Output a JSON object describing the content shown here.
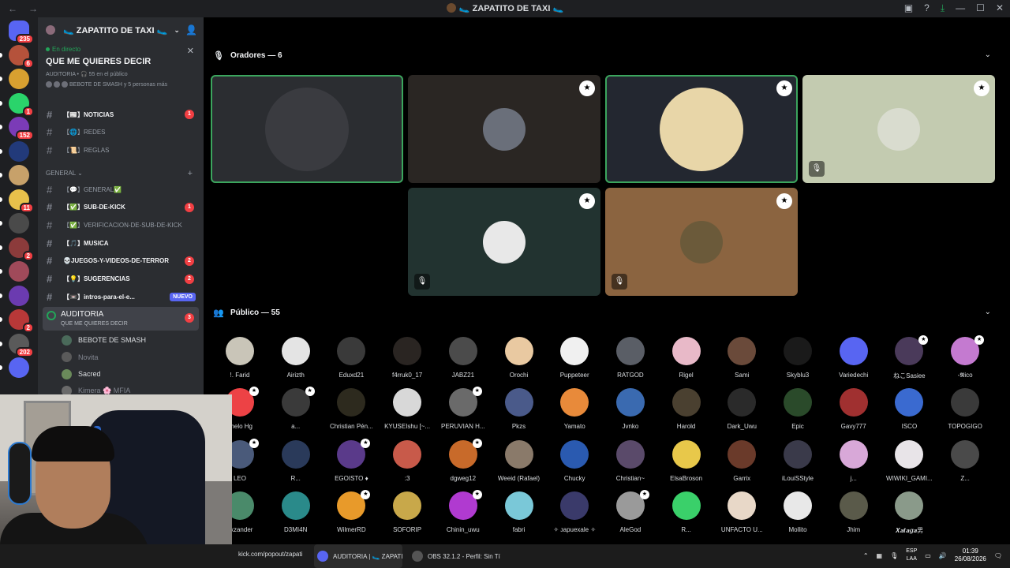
{
  "titlebar": {
    "back": "←",
    "forward": "→",
    "title": "🥿 ZAPATITO DE TAXI 🥿",
    "icons": [
      "inbox-icon",
      "help-icon",
      "download-icon"
    ],
    "min": "—",
    "max": "☐",
    "close": "✕"
  },
  "guilds": [
    {
      "name": "home-icon",
      "color": "#5865f2",
      "badge": "235"
    },
    {
      "name": "server-1",
      "color": "#b5523b",
      "badge": "6"
    },
    {
      "name": "server-2",
      "color": "#d8a030",
      "badge": ""
    },
    {
      "name": "server-kick",
      "color": "#2ad46b",
      "badge": "1"
    },
    {
      "name": "server-4",
      "color": "#7b3bb7",
      "badge": "152"
    },
    {
      "name": "server-kp",
      "color": "#223a7a",
      "badge": ""
    },
    {
      "name": "server-6",
      "color": "#c7a16a",
      "badge": ""
    },
    {
      "name": "server-7",
      "color": "#e8c14b",
      "badge": "11"
    },
    {
      "name": "server-8",
      "color": "#4a4a4a",
      "badge": ""
    },
    {
      "name": "server-9",
      "color": "#8c3b3b",
      "badge": "2"
    },
    {
      "name": "server-10",
      "color": "#a04a5a",
      "badge": ""
    },
    {
      "name": "server-11",
      "color": "#6b3bb0",
      "badge": ""
    },
    {
      "name": "server-12",
      "color": "#b83838",
      "badge": "2"
    },
    {
      "name": "server-13",
      "color": "#5a5a5a",
      "badge": "202"
    },
    {
      "name": "server-14",
      "color": "#5865f2",
      "badge": ""
    }
  ],
  "server": {
    "name": "🥿 ZAPATITO DE TAXI 🥿",
    "stage": {
      "live": "En directo",
      "title": "QUE ME QUIERES DECIR",
      "meta": "AUDITORIA • 🎧 55 en el público",
      "people": "BEBOTE DE SMASH y 5 personas más"
    },
    "channels": [
      {
        "label": "【📰】NOTICIAS",
        "bold": true,
        "badge": "1"
      },
      {
        "label": "【🌐】REDES",
        "bold": false,
        "badge": ""
      },
      {
        "label": "【📜】REGLAS",
        "bold": false,
        "badge": ""
      }
    ],
    "category": "GENERAL",
    "channels2": [
      {
        "label": "【💬】GENERAL✅",
        "bold": false,
        "badge": ""
      },
      {
        "label": "【✅】SUB-DE-KICK",
        "bold": true,
        "badge": "1"
      },
      {
        "label": "【✅】VERIFICACION-DE-SUB-DE-KICK",
        "bold": false,
        "badge": ""
      },
      {
        "label": "【🎵】MUSICA",
        "bold": true,
        "badge": ""
      },
      {
        "label": "💀JUEGOS-Y-VIDEOS-DE-TERROR",
        "bold": true,
        "badge": "2"
      },
      {
        "label": "【💡】SUGERENCIAS",
        "bold": true,
        "badge": "2"
      },
      {
        "label": "【📼】intros-para-el-e...",
        "bold": true,
        "badge": "NUEVO"
      }
    ],
    "stage_channel": {
      "name": "AUDITORIA",
      "sub": "QUE ME QUIERES DECIR",
      "badge": "3"
    },
    "voice_users": [
      {
        "name": "BEBOTE DE SMASH",
        "dim": false
      },
      {
        "name": "Novita",
        "dim": true
      },
      {
        "name": "Sacred",
        "dim": false
      },
      {
        "name": "Kimera 🌸 MFIA",
        "dim": true
      }
    ]
  },
  "speakers": {
    "header": "Oradores — 6",
    "tiles": [
      {
        "name": "speaker-1",
        "bg": "#2b2d31",
        "avatar": "#3a3b40",
        "speaking": true,
        "mod": false,
        "muted": false,
        "big": true
      },
      {
        "name": "speaker-2",
        "bg": "#2a2623",
        "avatar": "#6a6f7a",
        "speaking": false,
        "mod": true,
        "muted": false,
        "big": false
      },
      {
        "name": "speaker-3",
        "bg": "#232730",
        "avatar": "#e8d6a8",
        "speaking": true,
        "mod": true,
        "muted": false,
        "big": true
      },
      {
        "name": "speaker-4",
        "bg": "#c3cbb0",
        "avatar": "#d9dccf",
        "speaking": false,
        "mod": true,
        "muted": true,
        "big": false
      },
      {
        "name": "speaker-5",
        "bg": "#223330",
        "avatar": "#e8e8e8",
        "speaking": false,
        "mod": true,
        "muted": true,
        "big": false
      },
      {
        "name": "speaker-6",
        "bg": "#8b6440",
        "avatar": "#6b5a3a",
        "speaking": false,
        "mod": true,
        "muted": true,
        "big": false
      }
    ]
  },
  "audience": {
    "header": "Público — 55",
    "rows": [
      [
        {
          "name": "!. Farid",
          "color": "#c9c5b8",
          "mod": false
        },
        {
          "name": "Airizth",
          "color": "#e4e4e4",
          "mod": false
        },
        {
          "name": "Eduxd21",
          "color": "#3a3a3a",
          "mod": false
        },
        {
          "name": "f4rruk0_17",
          "color": "#2a2522",
          "mod": false
        },
        {
          "name": "JABZ21",
          "color": "#4b4b4b",
          "mod": false
        },
        {
          "name": "Orochi",
          "color": "#e9c9a1",
          "mod": false
        },
        {
          "name": "Puppeteer",
          "color": "#f0f0f0",
          "mod": false
        },
        {
          "name": "RATGOD",
          "color": "#5a5e66",
          "mod": false
        },
        {
          "name": "Rigel",
          "color": "#e8b9c8",
          "mod": false
        },
        {
          "name": "Sami",
          "color": "#6a4a3a",
          "mod": false
        },
        {
          "name": "Skyblu3",
          "color": "#1a1a1a",
          "mod": false
        },
        {
          "name": "Variedechi",
          "color": "#5865f2",
          "mod": false
        },
        {
          "name": "ねこSasiee",
          "color": "#4a3a5a",
          "mod": true
        },
        {
          "name": "-𝕹ico",
          "color": "#c47ad0",
          "mod": true
        }
      ],
      [
        {
          "name": "ghelo Hg",
          "color": "#ed4245",
          "mod": true
        },
        {
          "name": "a...",
          "color": "#3a3a3a",
          "mod": true
        },
        {
          "name": "Christian Pén...",
          "color": "#2d2a1e",
          "mod": false
        },
        {
          "name": "KYUSEIshu [~...",
          "color": "#d8d8d8",
          "mod": false
        },
        {
          "name": "PERUVIAN H...",
          "color": "#6a6a6a",
          "mod": true
        },
        {
          "name": "Pkzs",
          "color": "#4a5a8a",
          "mod": false
        },
        {
          "name": "Yamato",
          "color": "#e88a3a",
          "mod": false
        },
        {
          "name": "Jvnko",
          "color": "#3a6ab0",
          "mod": false
        },
        {
          "name": "Harold",
          "color": "#4a4030",
          "mod": false
        },
        {
          "name": "Dark_Uwu",
          "color": "#2a2a2a",
          "mod": false
        },
        {
          "name": "Epic",
          "color": "#2a4a2a",
          "mod": false
        },
        {
          "name": "Gavy777",
          "color": "#a03030",
          "mod": false
        },
        {
          "name": "ISCO",
          "color": "#3a6ad0",
          "mod": false
        },
        {
          "name": "TOPOGIGO",
          "color": "#3a3a3a",
          "mod": false
        }
      ],
      [
        {
          "name": "LEO",
          "color": "#4a5a7a",
          "mod": true
        },
        {
          "name": "R...",
          "color": "#2a3a5a",
          "mod": false
        },
        {
          "name": "EGOISTO ♦",
          "color": "#5a3a8a",
          "mod": true
        },
        {
          "name": ":3",
          "color": "#c85a4a",
          "mod": false
        },
        {
          "name": "dgweg12",
          "color": "#c86a2a",
          "mod": true
        },
        {
          "name": "Weeid (Rafael)",
          "color": "#8a7a6a",
          "mod": false
        },
        {
          "name": "Chucky",
          "color": "#2a5ab0",
          "mod": false
        },
        {
          "name": "Christian~",
          "color": "#5a4a6a",
          "mod": false
        },
        {
          "name": "ElsaBroson",
          "color": "#e8c84a",
          "mod": false
        },
        {
          "name": "Garrix",
          "color": "#6a3a2a",
          "mod": false
        },
        {
          "name": "iLouiSStyle",
          "color": "#3a3a4a",
          "mod": false
        },
        {
          "name": "j...",
          "color": "#d8a8d8",
          "mod": false
        },
        {
          "name": "WIWIKI_GAMI...",
          "color": "#e8e4e8",
          "mod": false
        },
        {
          "name": "Z...",
          "color": "#4a4a4a",
          "mod": false
        }
      ],
      [
        {
          "name": "exzander",
          "color": "#4a8a6a",
          "mod": false
        },
        {
          "name": "D3MI4N",
          "color": "#2a8a8a",
          "mod": false
        },
        {
          "name": "WilmerRD",
          "color": "#e89a2a",
          "mod": true
        },
        {
          "name": "SOFORIP",
          "color": "#c8a84a",
          "mod": false
        },
        {
          "name": "Chinin_uwu",
          "color": "#b03ad0",
          "mod": true
        },
        {
          "name": "fabri",
          "color": "#7ac8d8",
          "mod": false
        },
        {
          "name": "✧ ᴊapuexale ✧",
          "color": "#3a3a6a",
          "mod": false
        },
        {
          "name": "AleGod",
          "color": "#9a9a9a",
          "mod": true
        },
        {
          "name": "R...",
          "color": "#3ad06a",
          "mod": false
        },
        {
          "name": "UNFACTO U...",
          "color": "#e8d8c8",
          "mod": false
        },
        {
          "name": "Mollito",
          "color": "#e8e8e8",
          "mod": false
        },
        {
          "name": "Jhim",
          "color": "#5a5a4a",
          "mod": false
        },
        {
          "name": "𝑿𝒂𝒕𝒂𝒈𝒂男",
          "color": "#8a9a8a",
          "mod": false
        }
      ]
    ]
  },
  "taskbar": {
    "items": [
      {
        "label": "kick.com/popout/zapati",
        "color": "#53fc18"
      },
      {
        "label": "AUDITORIA | 🥿 ZAPATI",
        "color": "#5865f2"
      },
      {
        "label": "OBS 32.1.2 - Perfil: Sin Tí",
        "color": "#555"
      }
    ],
    "lang_1": "ESP",
    "lang_2": "LAA",
    "time": "01:39",
    "date": "26/08/2026"
  }
}
